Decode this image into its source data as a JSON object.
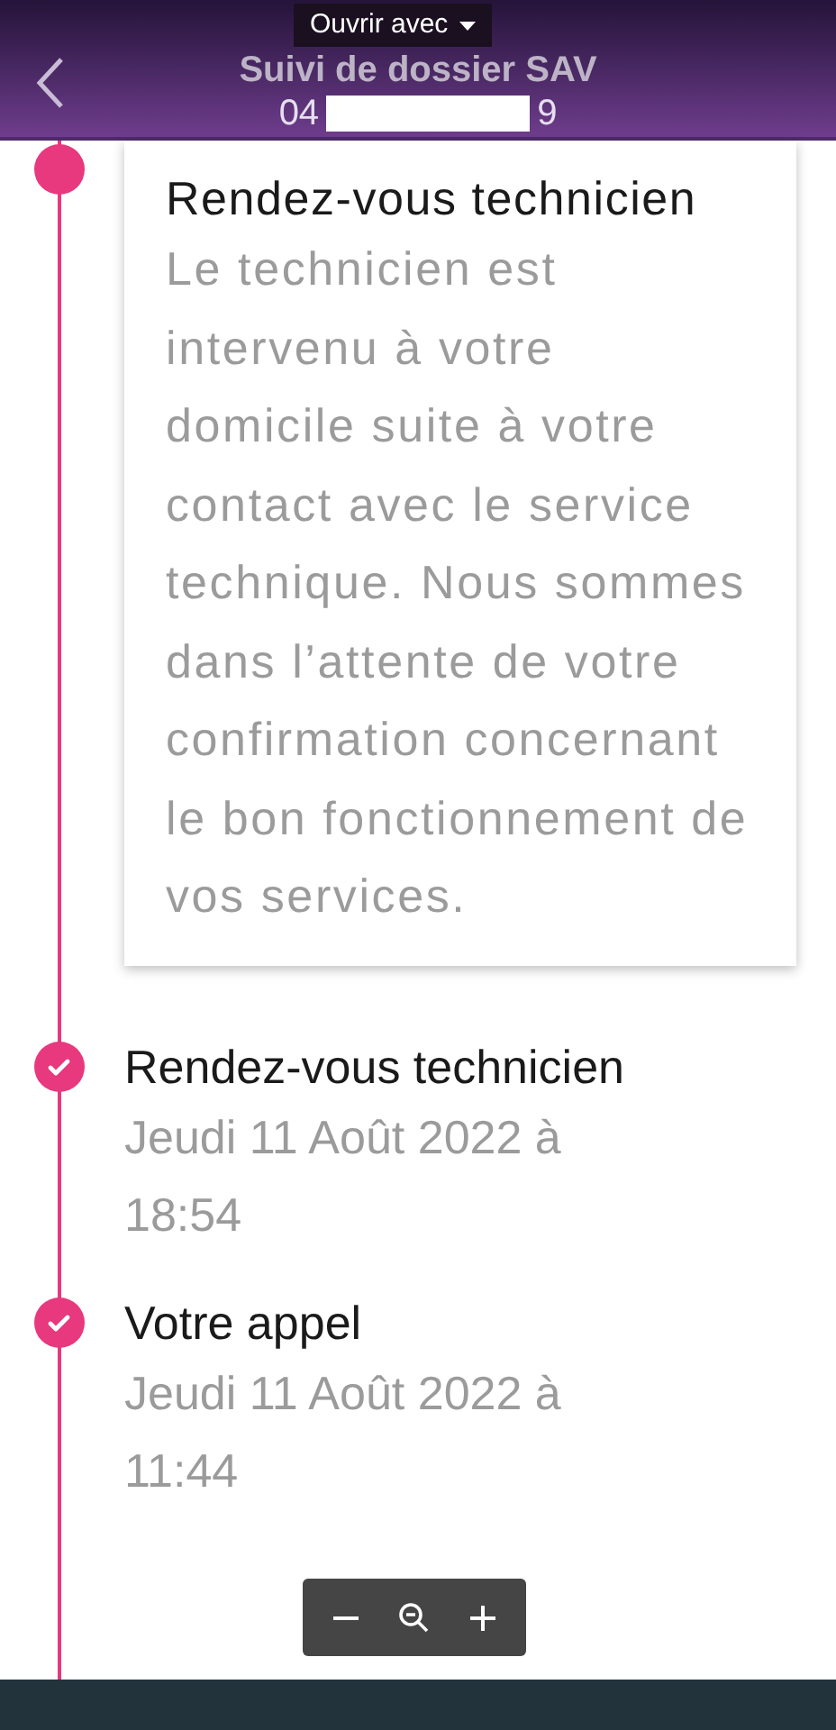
{
  "header": {
    "title": "Suivi de dossier SAV",
    "subtitle_start": "04",
    "subtitle_end": "9"
  },
  "popup": {
    "label": "Ouvrir avec"
  },
  "steps": [
    {
      "done": false,
      "title": "Rendez-vous technicien",
      "description": "Le technicien est intervenu à votre domicile suite à votre contact avec le service technique. Nous sommes dans l’attente de votre confirmation concernant le bon fonctionnement de vos services."
    },
    {
      "done": true,
      "title": "Rendez-vous technicien",
      "description": "Jeudi 11 Août 2022 à 18:54"
    },
    {
      "done": true,
      "title": "Votre appel",
      "description": "Jeudi 11 Août 2022 à 11:44"
    }
  ]
}
